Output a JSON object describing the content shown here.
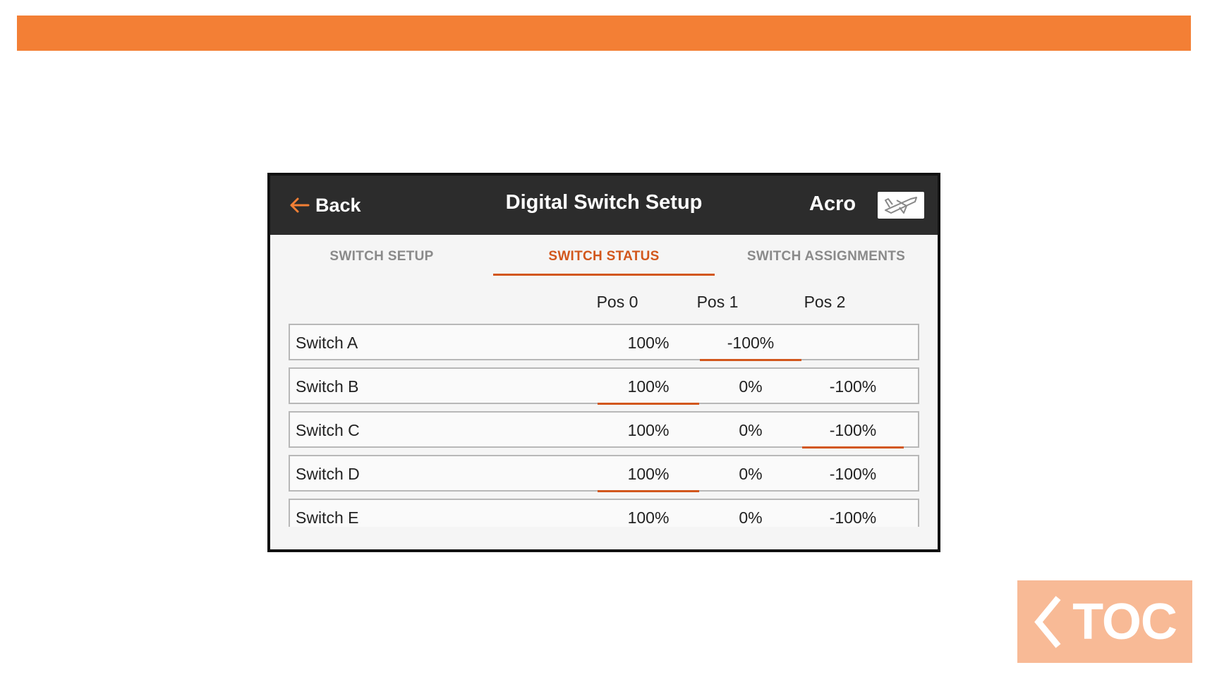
{
  "colors": {
    "accent": "#f37f35",
    "active_tab": "#d2571c",
    "header_bg": "#2c2c2c",
    "toc_bg": "#f8ba96"
  },
  "header": {
    "back_label": "Back",
    "title": "Digital Switch Setup",
    "model": "Acro",
    "model_icon": "airplane-icon"
  },
  "tabs": [
    {
      "label": "SWITCH SETUP",
      "active": false
    },
    {
      "label": "SWITCH STATUS",
      "active": true
    },
    {
      "label": "SWITCH ASSIGNMENTS",
      "active": false
    }
  ],
  "columns": [
    "Pos 0",
    "Pos 1",
    "Pos 2"
  ],
  "rows": [
    {
      "label": "Switch A",
      "values": [
        "100%",
        "-100%",
        ""
      ],
      "active_index": 1
    },
    {
      "label": "Switch B",
      "values": [
        "100%",
        "0%",
        "-100%"
      ],
      "active_index": 0
    },
    {
      "label": "Switch C",
      "values": [
        "100%",
        "0%",
        "-100%"
      ],
      "active_index": 2
    },
    {
      "label": "Switch D",
      "values": [
        "100%",
        "0%",
        "-100%"
      ],
      "active_index": 0
    },
    {
      "label": "Switch E",
      "values": [
        "100%",
        "0%",
        "-100%"
      ],
      "active_index": null
    }
  ],
  "toc": {
    "label": "TOC",
    "icon": "chevron-left-icon"
  }
}
